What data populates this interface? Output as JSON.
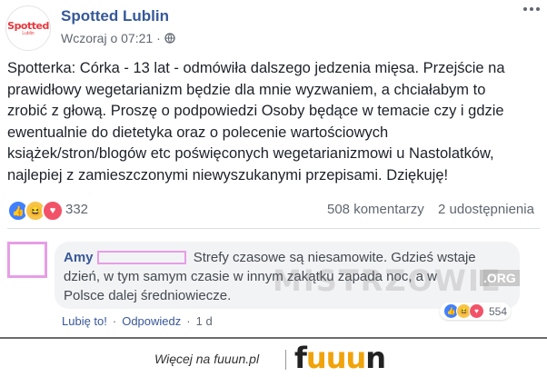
{
  "post": {
    "avatar_logo": "Spotted",
    "avatar_sub": "Lublin",
    "page_name": "Spotted Lublin",
    "timestamp": "Wczoraj o 07:21",
    "text_lines": [
      "Spotterka: Córka - 13 lat - odmówiła dalszego jedzenia mięsa. Przejście na",
      "prawidłowy wegetarianizm będzie dla mnie wyzwaniem, a chciałabym to",
      "zrobić z głową. Proszę o podpowiedzi Osoby będące w temacie czy i gdzie",
      "ewentualnie do dietetyka oraz o polecenie wartościowych",
      "książek/stron/blogów etc poświęconych wegetarianizmowi u Nastolatków,",
      "najlepiej z zamieszczonymi niewyszukanymi przepisami. Dziękuję!"
    ],
    "reaction_count": "332",
    "comments_count": "508 komentarzy",
    "shares_count": "2 udostępnienia"
  },
  "comment": {
    "author": "Amy",
    "lines": [
      "Strefy czasowe są niesamowite. Gdzieś wstaje",
      "dzień, w tym samym czasie w innym zakątku zapada noc, a w",
      "Polsce dalej średniowiecze."
    ],
    "like_label": "Lubię to!",
    "reply_label": "Odpowiedz",
    "age": "1 d",
    "reaction_count": "554",
    "separator": "·"
  },
  "watermark": {
    "text": "MISTRZOWIE",
    "org": ".ORG"
  },
  "footer": {
    "text": "Więcej na fuuun.pl",
    "logo_f": "f",
    "logo_u": "uuu",
    "logo_n": "n"
  },
  "colors": {
    "link": "#365899",
    "like": "#4080ff",
    "love": "#f25268",
    "haha": "#f7c34a",
    "fuuun_accent": "#f0a30a"
  },
  "icons": {
    "globe": "globe-icon",
    "menu": "more-options-icon",
    "like": "like-reaction-icon",
    "haha": "haha-reaction-icon",
    "love": "love-reaction-icon"
  }
}
